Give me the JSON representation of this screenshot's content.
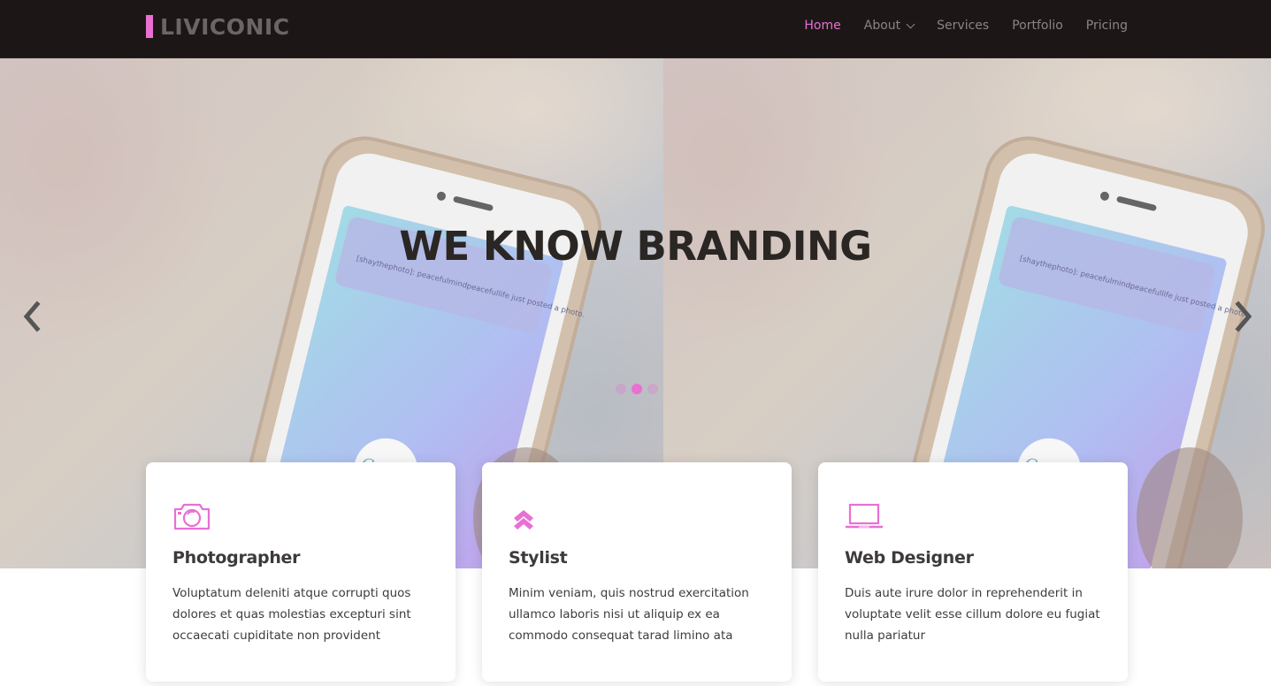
{
  "brand": {
    "name": "LIVICONIC"
  },
  "nav": {
    "items": [
      {
        "label": "Home",
        "active": true
      },
      {
        "label": "About",
        "dropdown": true
      },
      {
        "label": "Services"
      },
      {
        "label": "Portfolio"
      },
      {
        "label": "Pricing"
      }
    ]
  },
  "hero": {
    "title": "WE KNOW BRANDING",
    "phone_notification": "[shaythephoto]: peacefulmindpeacefullife just posted a photo.",
    "phone_logo": "Canva",
    "slide_count": 3,
    "active_slide": 2
  },
  "cards": [
    {
      "icon": "camera-icon",
      "title": "Photographer",
      "text": "Voluptatum deleniti atque corrupti quos dolores et quas molestias excepturi sint occaecati cupiditate non provident"
    },
    {
      "icon": "chevrons-up-icon",
      "title": "Stylist",
      "text": "Minim veniam, quis nostrud exercitation ullamco laboris nisi ut aliquip ex ea commodo consequat tarad limino ata"
    },
    {
      "icon": "laptop-icon",
      "title": "Web Designer",
      "text": "Duis aute irure dolor in reprehenderit in voluptate velit esse cillum dolore eu fugiat nulla pariatur"
    }
  ],
  "colors": {
    "accent": "#e96fd3",
    "navbar_bg": "#1c1716",
    "nav_text": "#8a8584",
    "title_text": "#2a2624"
  }
}
